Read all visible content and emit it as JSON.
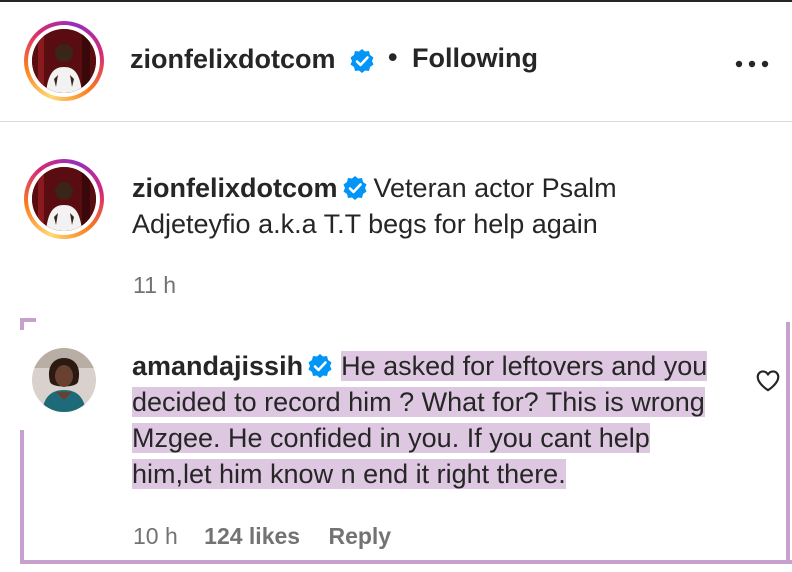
{
  "post": {
    "username": "zionfelixdotcom",
    "verified": true,
    "separator": "•",
    "follow_status": "Following",
    "more_icon": "more-horizontal-icon"
  },
  "caption": {
    "username": "zionfelixdotcom",
    "text": "Veteran actor Psalm Adjeteyfio a.k.a T.T begs for help again",
    "time": "11 h"
  },
  "comment": {
    "username": "amandajissih",
    "text": "He asked for leftovers and you decided to record him ? What for? This is wrong Mzgee. He confided in you. If you cant help him,let him know n end it right there.",
    "time": "10 h",
    "likes": "124 likes",
    "reply_label": "Reply",
    "like_icon": "heart-outline-icon",
    "highlight_color": "#dec8e1"
  },
  "colors": {
    "text": "#262626",
    "secondary": "#737373",
    "verified_blue": "#0095f6",
    "annotation": "#c7a1cd"
  }
}
